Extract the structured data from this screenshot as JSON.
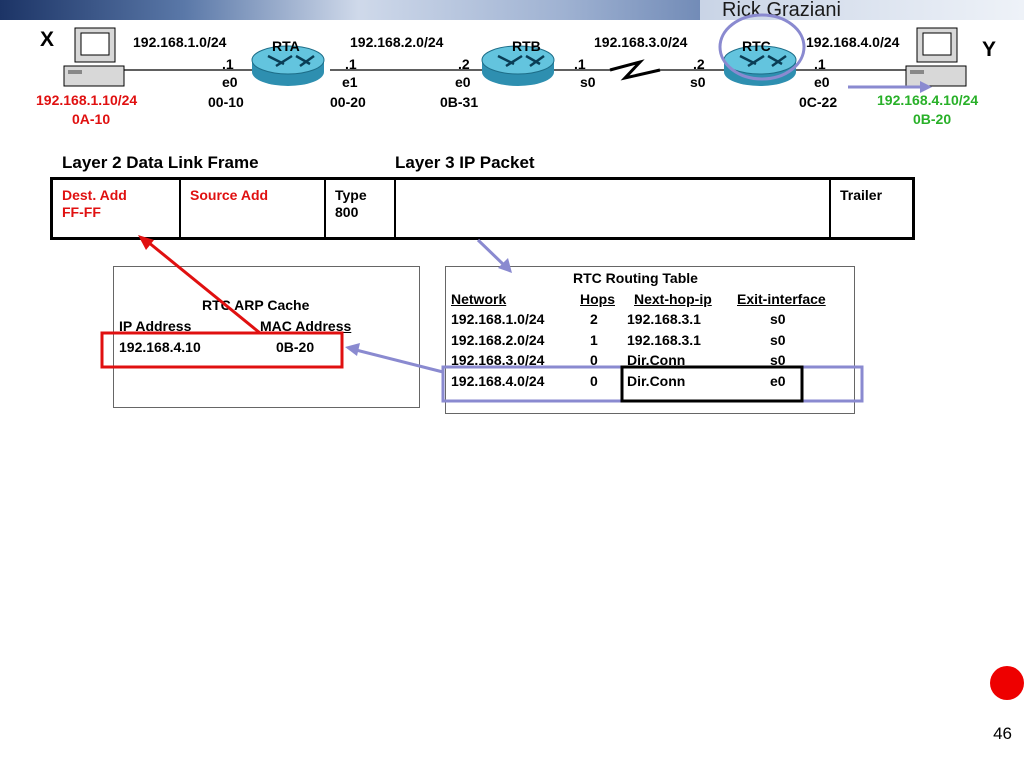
{
  "header": {
    "author": "Rick Graziani"
  },
  "topology": {
    "host_x": {
      "label": "X",
      "ip": "192.168.1.10/24",
      "mac": "0A-10"
    },
    "host_y": {
      "label": "Y",
      "ip": "192.168.4.10/24",
      "mac": "0B-20"
    },
    "networks": [
      "192.168.1.0/24",
      "192.168.2.0/24",
      "192.168.3.0/24",
      "192.168.4.0/24"
    ],
    "routers": [
      {
        "name": "RTA",
        "left_octet": ".1",
        "left_if": "e0",
        "left_mac": "00-10",
        "right_octet": ".1",
        "right_if": "e1",
        "right_mac": "00-20"
      },
      {
        "name": "RTB",
        "left_octet": ".2",
        "left_if": "e0",
        "left_mac": "0B-31",
        "right_octet": ".1",
        "right_if": "s0"
      },
      {
        "name": "RTC",
        "left_octet": ".2",
        "left_if": "s0",
        "right_octet": ".1",
        "right_if": "e0",
        "right_mac": "0C-22"
      }
    ]
  },
  "frame": {
    "l2_title": "Layer 2 Data Link Frame",
    "l3_title": "Layer 3 IP Packet",
    "dest_label": "Dest. Add",
    "dest_value": "FF-FF",
    "src_label": "Source Add",
    "type_label": "Type",
    "type_value": "800",
    "trailer_label": "Trailer"
  },
  "arp_cache": {
    "title": "RTC ARP Cache",
    "col_ip": "IP Address",
    "col_mac": "MAC Address",
    "rows": [
      {
        "ip": "192.168.4.10",
        "mac": "0B-20"
      }
    ]
  },
  "routing_table": {
    "title": "RTC Routing Table",
    "headers": {
      "network": "Network",
      "hops": "Hops",
      "next_hop": "Next-hop-ip",
      "exit": "Exit-interface"
    },
    "rows": [
      {
        "network": "192.168.1.0/24",
        "hops": "2",
        "next_hop": "192.168.3.1",
        "exit": "s0"
      },
      {
        "network": "192.168.2.0/24",
        "hops": "1",
        "next_hop": "192.168.3.1",
        "exit": "s0"
      },
      {
        "network": "192.168.3.0/24",
        "hops": "0",
        "next_hop": "Dir.Conn",
        "exit": "s0"
      },
      {
        "network": "192.168.4.0/24",
        "hops": "0",
        "next_hop": "Dir.Conn",
        "exit": "e0"
      }
    ]
  },
  "page_number": "46",
  "colors": {
    "highlight_red": "#e01010",
    "highlight_blue": "#8a8ad0",
    "host_x_text": "#e01010",
    "host_y_text": "#28b028"
  }
}
